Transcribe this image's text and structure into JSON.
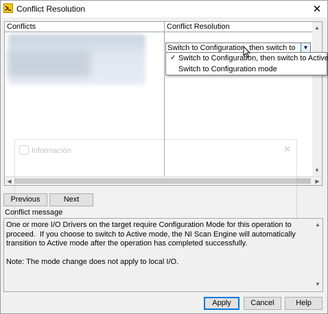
{
  "window": {
    "title": "Conflict Resolution",
    "icon": "labview-app-icon"
  },
  "table": {
    "columns": [
      "Conflicts",
      "Conflict Resolution"
    ],
    "combo_value": "Switch to Configuration, then switch to",
    "dropdown_options": [
      {
        "label": "Switch to Configuration, then switch to Active",
        "checked": true
      },
      {
        "label": "Switch to Configuration mode",
        "checked": false
      }
    ]
  },
  "ghost_dialog": {
    "title": "Información"
  },
  "nav": {
    "previous": "Previous",
    "next": "Next"
  },
  "message": {
    "label": "Conflict message",
    "text": "One or more I/O Drivers on the target require Configuration Mode for this operation to proceed.  If you choose to switch to Active mode, the NI Scan Engine will automatically transition to Active mode after the operation has completed successfully.\n\nNote: The mode change does not apply to local I/O."
  },
  "buttons": {
    "apply": "Apply",
    "cancel": "Cancel",
    "help": "Help"
  }
}
